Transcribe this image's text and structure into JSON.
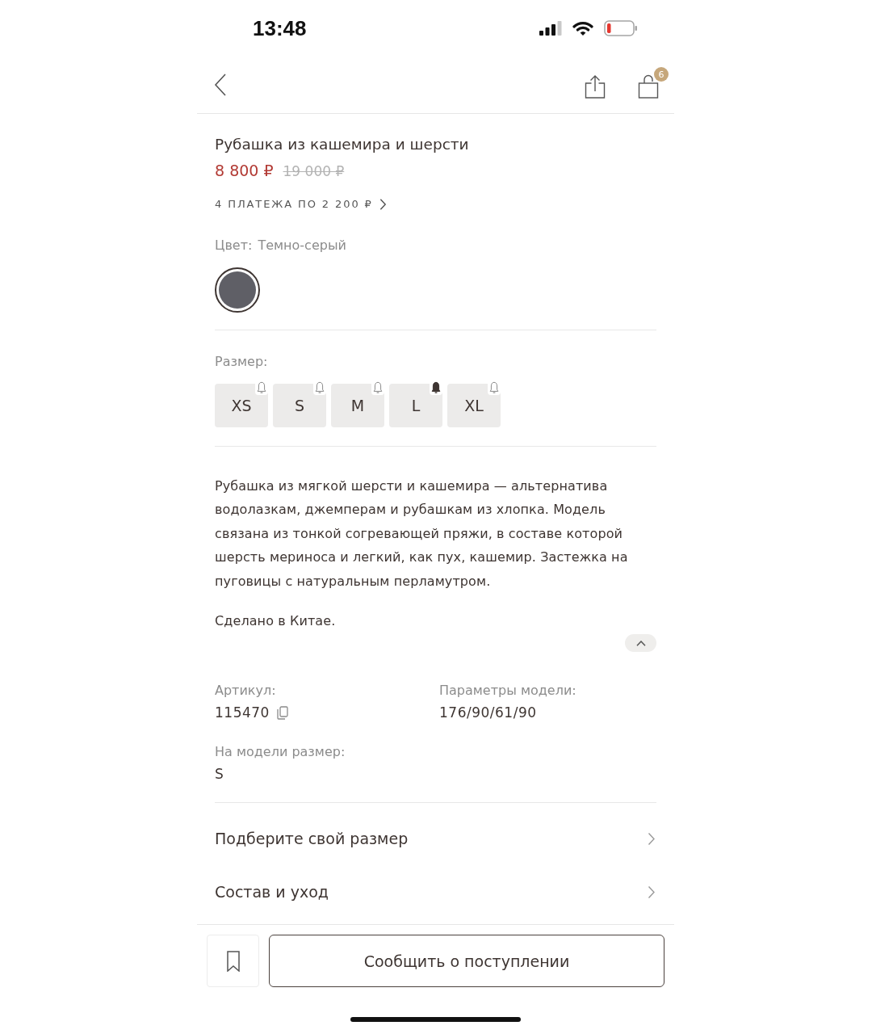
{
  "status_bar": {
    "time": "13:48"
  },
  "header": {
    "cart_badge": "6"
  },
  "product": {
    "title": "Рубашка из кашемира и шерсти",
    "price": "8 800 ₽",
    "old_price": "19 000 ₽",
    "installments": "4 ПЛАТЕЖА ПО 2 200 ₽"
  },
  "color": {
    "label": "Цвет:",
    "value": "Темно-серый",
    "swatches": [
      {
        "color": "#5f5f66",
        "selected": true
      }
    ]
  },
  "sizes": {
    "label": "Размер:",
    "items": [
      {
        "label": "XS",
        "selected": false,
        "notify_on": false
      },
      {
        "label": "S",
        "selected": false,
        "notify_on": false
      },
      {
        "label": "M",
        "selected": false,
        "notify_on": false
      },
      {
        "label": "L",
        "selected": false,
        "notify_on": true
      },
      {
        "label": "XL",
        "selected": false,
        "notify_on": false
      }
    ]
  },
  "description": {
    "paragraphs": [
      "Рубашка из мягкой шерсти и кашемира — альтернатива водолазкам, джемперам и рубашкам из хлопка. Модель связана из тонкой согревающей пряжи, в составе которой шерсть мериноса и легкий, как пух, кашемир. Застежка на пуговицы с натуральным перламутром.",
      "Сделано в Китае."
    ],
    "expanded": true
  },
  "details": [
    {
      "label": "Артикул:",
      "value": "115470",
      "kind": "copyable"
    },
    {
      "label": "Параметры модели:",
      "value": "176/90/61/90",
      "kind": "plain"
    },
    {
      "label": "На модели размер:",
      "value": "S",
      "kind": "plain"
    }
  ],
  "links": [
    {
      "label": "Подберите свой размер"
    },
    {
      "label": "Состав и уход"
    }
  ],
  "actions": {
    "notify_button": "Сообщить о поступлении"
  }
}
